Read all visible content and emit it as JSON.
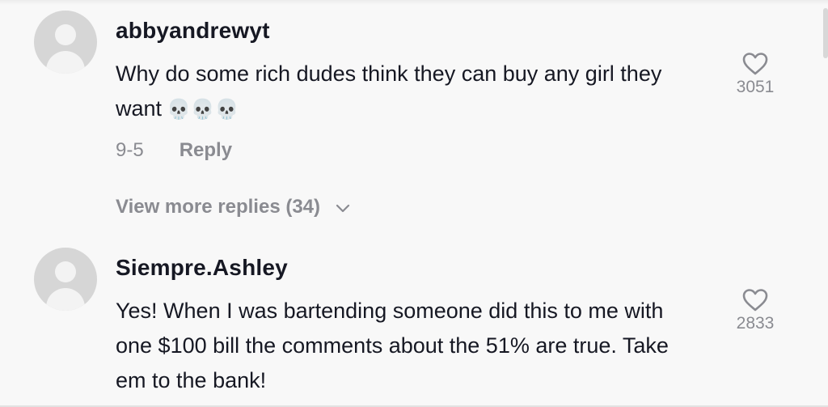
{
  "comments": [
    {
      "username": "abbyandrewyt",
      "text": "Why do some rich dudes think they can buy any girl they want",
      "emoji": "💀💀💀",
      "date": "9-5",
      "reply_label": "Reply",
      "likes": "3051",
      "view_more": "View more replies (34)"
    },
    {
      "username": "Siempre.Ashley",
      "text": "Yes! When I was bartending someone did this to me with one $100 bill the comments about the 51% are true. Take em to the bank!",
      "likes": "2833"
    }
  ]
}
